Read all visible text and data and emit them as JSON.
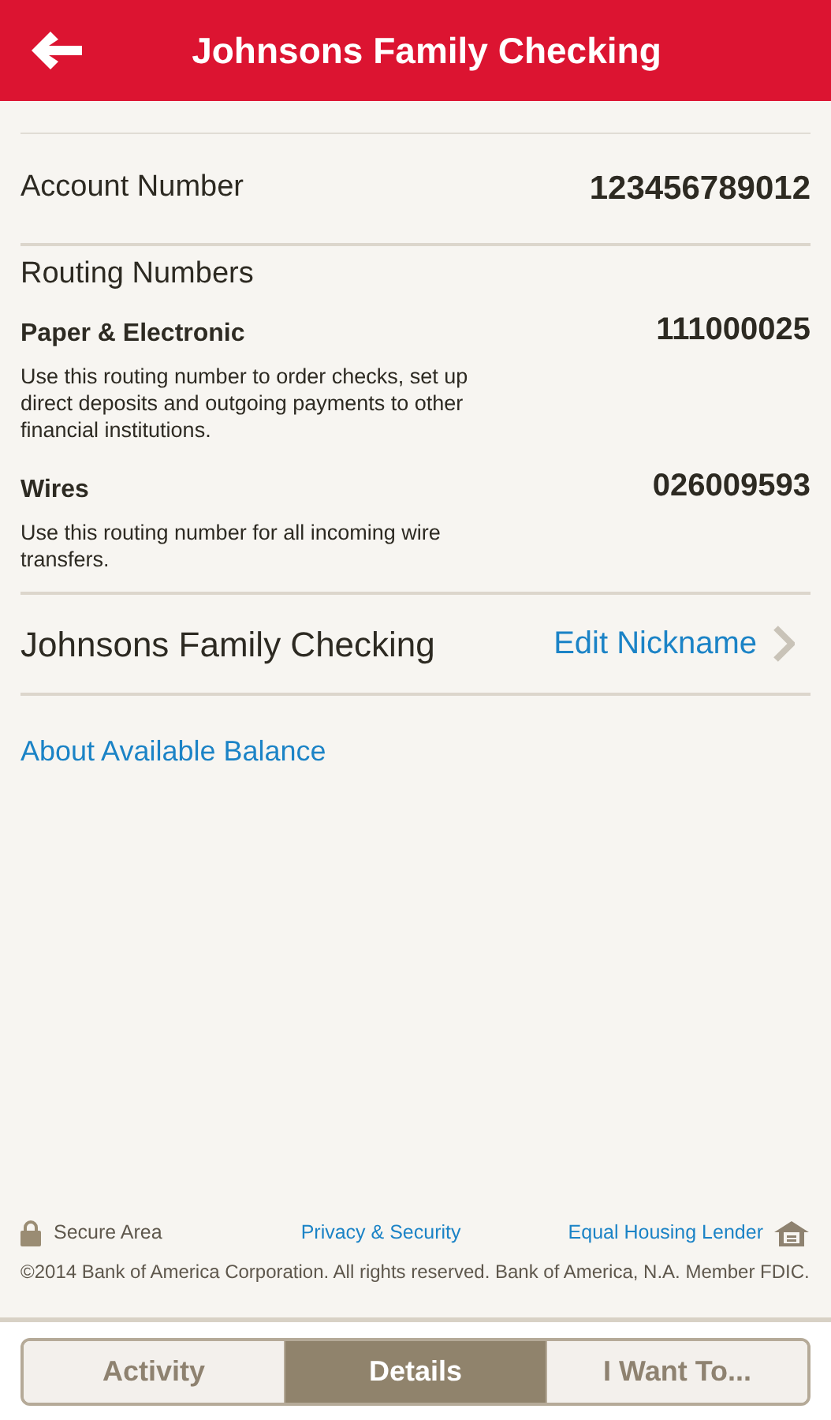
{
  "header": {
    "title": "Johnsons Family Checking"
  },
  "account": {
    "label": "Account Number",
    "value": "123456789012"
  },
  "routing": {
    "heading": "Routing Numbers",
    "items": [
      {
        "title": "Paper & Electronic",
        "number": "111000025",
        "description": "Use this routing number to order checks, set up direct deposits and outgoing payments to other financial institutions."
      },
      {
        "title": "Wires",
        "number": "026009593",
        "description": "Use this routing number for all incoming wire transfers."
      }
    ]
  },
  "nickname": {
    "name": "Johnsons Family Checking",
    "link": "Edit Nickname"
  },
  "balance_link": "About Available Balance",
  "footer": {
    "secure": "Secure Area",
    "privacy": "Privacy & Security",
    "housing": "Equal Housing Lender",
    "copyright": "©2014 Bank of America Corporation. All rights reserved. Bank of America, N.A. Member FDIC."
  },
  "tabs": [
    {
      "label": "Activity",
      "selected": false
    },
    {
      "label": "Details",
      "selected": true
    },
    {
      "label": "I Want To...",
      "selected": false
    }
  ]
}
